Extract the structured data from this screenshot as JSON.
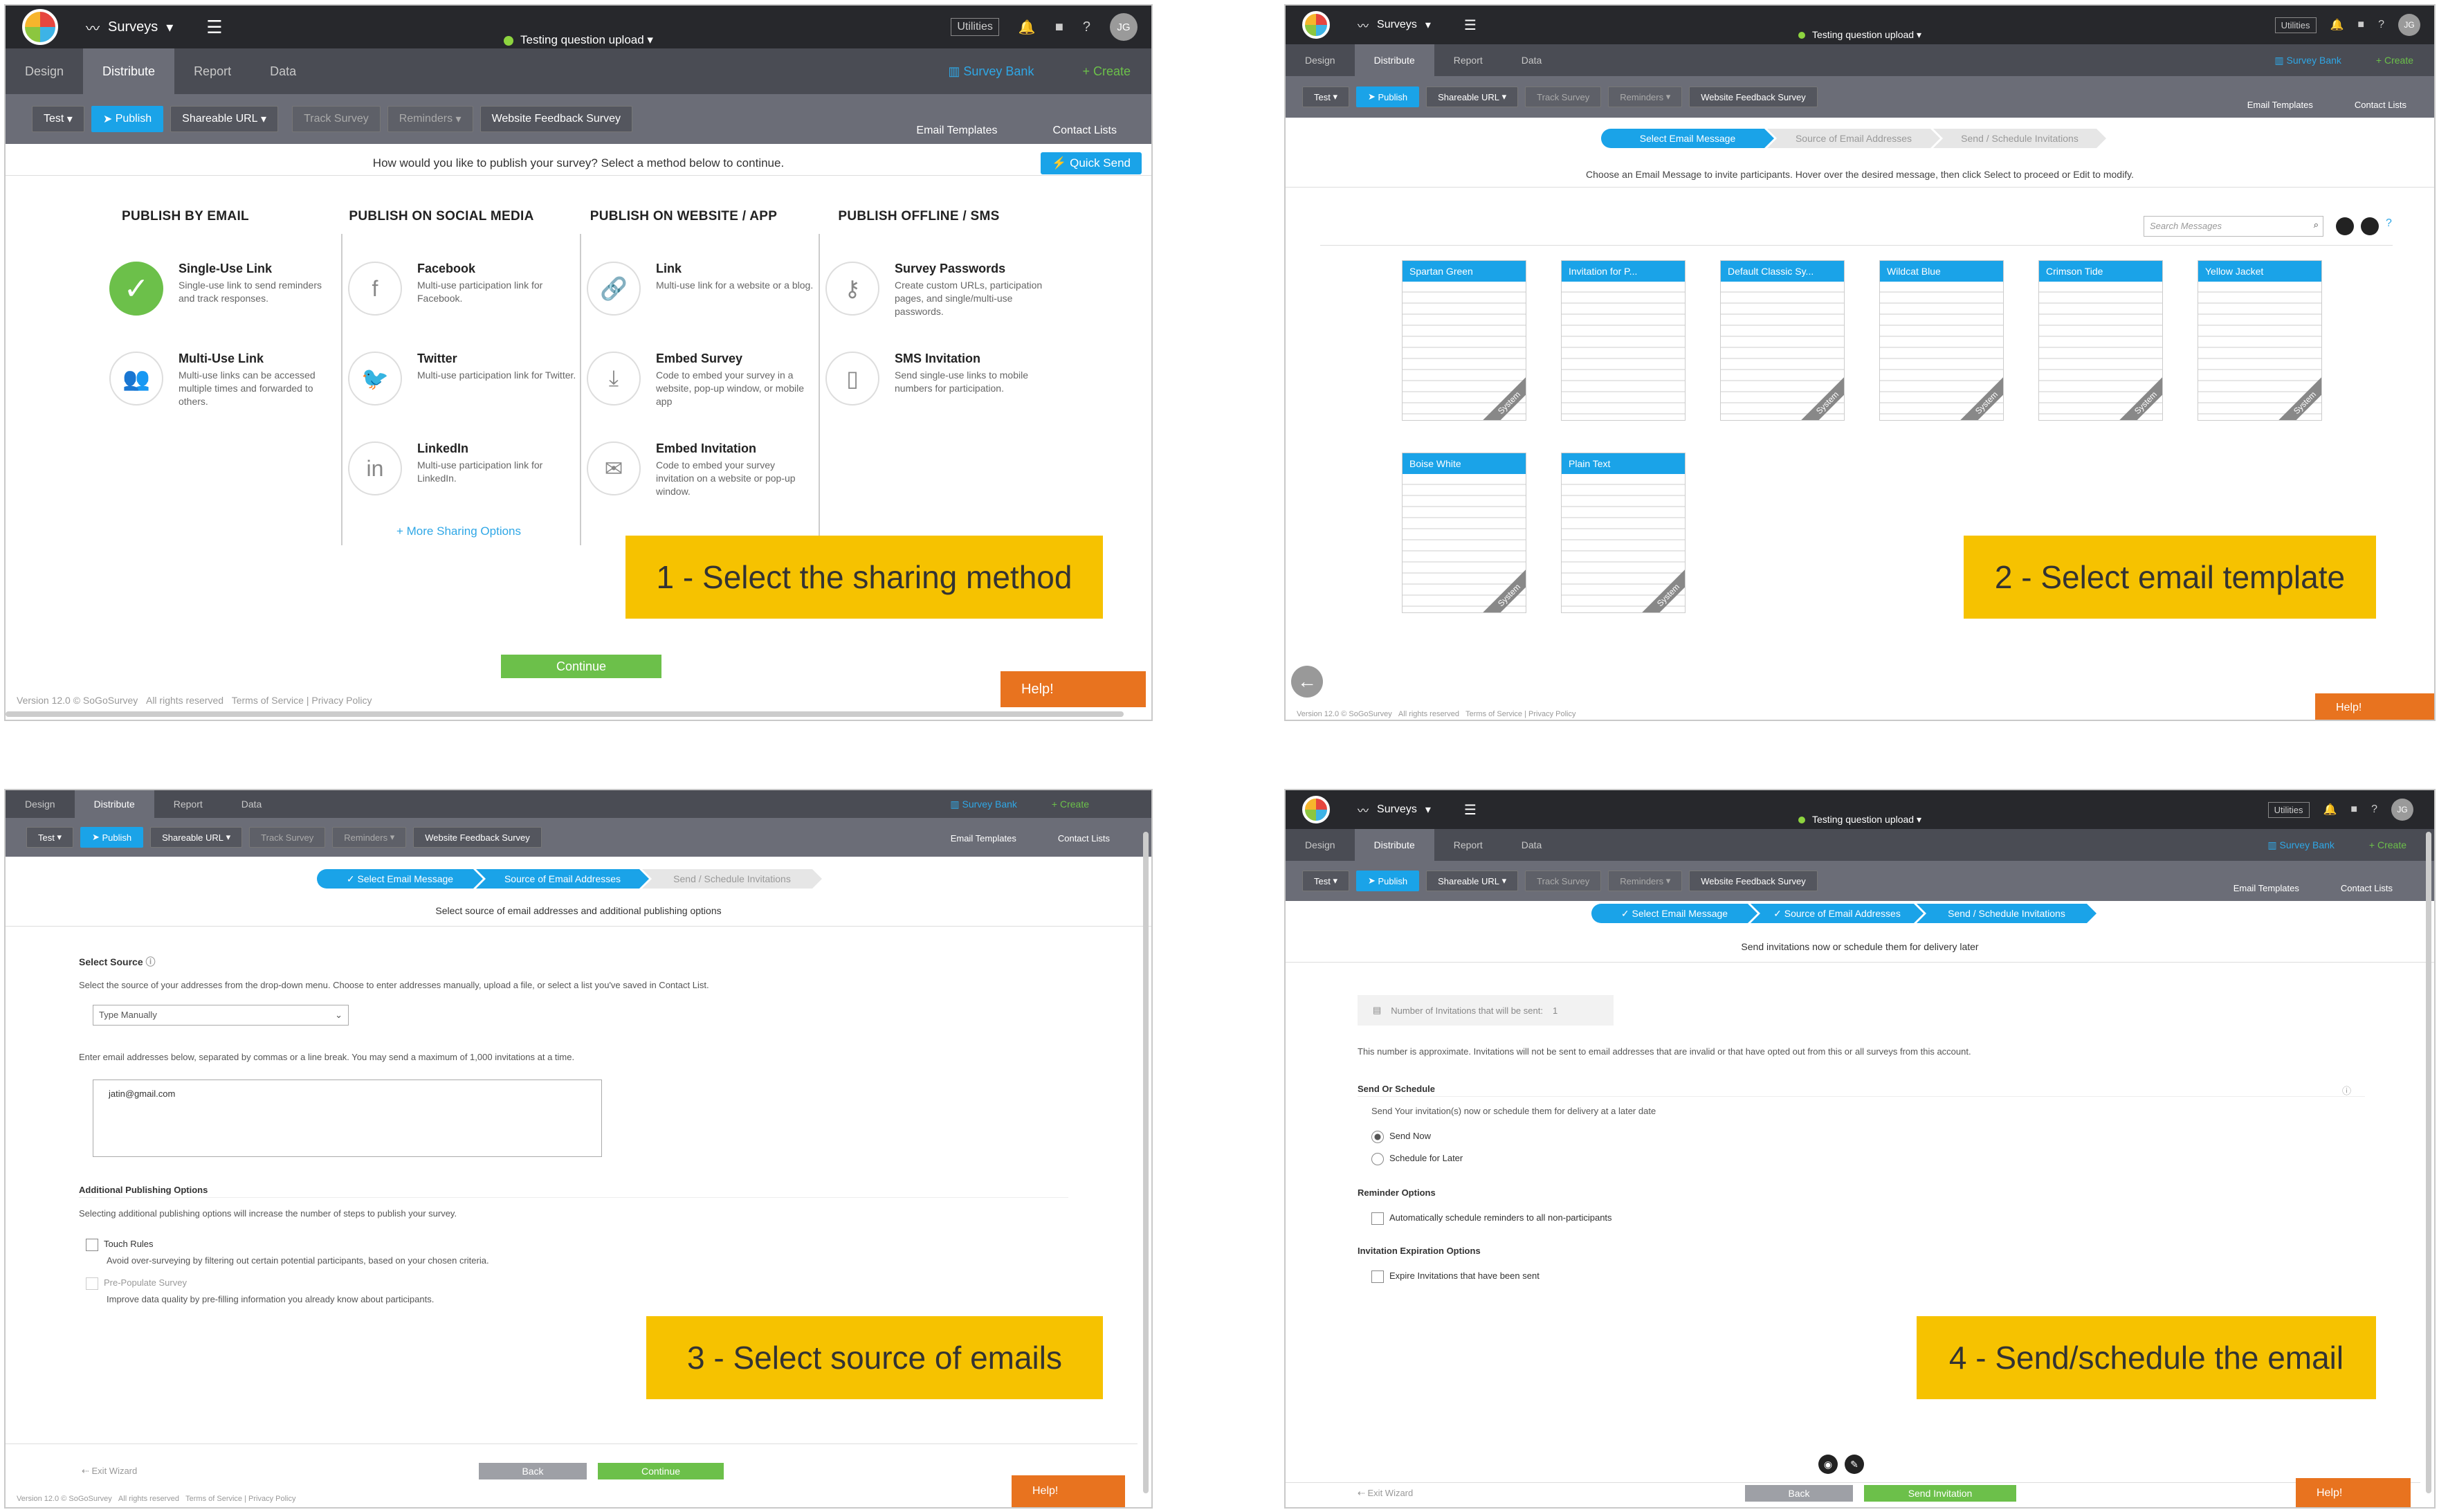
{
  "app": {
    "surveys_label": "Surveys",
    "survey_title": "Testing question upload",
    "utilities_label": "Utilities",
    "avatar_initials": "JG"
  },
  "tabs": [
    "Design",
    "Distribute",
    "Report",
    "Data"
  ],
  "tab_actions": {
    "survey_bank": "Survey Bank",
    "create": "Create"
  },
  "action_bar": {
    "test": "Test",
    "publish": "Publish",
    "shareable_url": "Shareable URL",
    "track_survey": "Track Survey",
    "reminders": "Reminders",
    "website_feedback": "Website Feedback Survey",
    "email_templates": "Email Templates",
    "contact_lists": "Contact Lists"
  },
  "panel1": {
    "question": "How would you like to publish your survey? Select a method below to continue.",
    "quick_send": "Quick Send",
    "columns": [
      {
        "header": "PUBLISH BY EMAIL",
        "items": [
          {
            "title": "Single-Use Link",
            "desc": "Single-use link to send reminders and track responses.",
            "icon": "check-icon"
          },
          {
            "title": "Multi-Use Link",
            "desc": "Multi-use links can be accessed multiple times and forwarded to others.",
            "icon": "people-icon"
          }
        ]
      },
      {
        "header": "PUBLISH ON SOCIAL MEDIA",
        "items": [
          {
            "title": "Facebook",
            "desc": "Multi-use participation link for Facebook.",
            "icon": "facebook-icon"
          },
          {
            "title": "Twitter",
            "desc": "Multi-use participation link for Twitter.",
            "icon": "twitter-icon"
          },
          {
            "title": "LinkedIn",
            "desc": "Multi-use participation link for LinkedIn.",
            "icon": "linkedin-icon"
          }
        ]
      },
      {
        "header": "PUBLISH ON WEBSITE / APP",
        "items": [
          {
            "title": "Link",
            "desc": "Multi-use link for a website or a blog.",
            "icon": "link-icon"
          },
          {
            "title": "Embed Survey",
            "desc": "Code to embed your survey in a website, pop-up window, or mobile app",
            "icon": "download-icon"
          },
          {
            "title": "Embed Invitation",
            "desc": "Code to embed your survey invitation on a website or pop-up window.",
            "icon": "mail-icon"
          }
        ]
      },
      {
        "header": "PUBLISH OFFLINE / SMS",
        "items": [
          {
            "title": "Survey Passwords",
            "desc": "Create custom URLs, participation pages, and single/multi-use passwords.",
            "icon": "key-icon"
          },
          {
            "title": "SMS Invitation",
            "desc": "Send single-use links to mobile numbers for participation.",
            "icon": "phone-icon"
          }
        ]
      }
    ],
    "more_sharing": "+ More Sharing Options",
    "continue": "Continue",
    "callout": "1 - Select the sharing method"
  },
  "panel2": {
    "steps": [
      "Select Email Message",
      "Source of Email Addresses",
      "Send / Schedule Invitations"
    ],
    "instruction": "Choose an Email Message to invite participants. Hover over the desired message, then click Select to proceed or Edit to modify.",
    "search_placeholder": "Search Messages",
    "templates": [
      {
        "name": "Spartan Green",
        "color": "#1aa3e8"
      },
      {
        "name": "Invitation for P...",
        "color": "#1aa3e8"
      },
      {
        "name": "Default Classic Sy...",
        "color": "#1aa3e8"
      },
      {
        "name": "Wildcat Blue",
        "color": "#1aa3e8"
      },
      {
        "name": "Crimson Tide",
        "color": "#1aa3e8"
      },
      {
        "name": "Yellow Jacket",
        "color": "#1aa3e8"
      },
      {
        "name": "Boise White",
        "color": "#1aa3e8"
      },
      {
        "name": "Plain Text",
        "color": "#1aa3e8"
      }
    ],
    "system_label": "System",
    "callout": "2 - Select email template"
  },
  "panel3": {
    "steps": [
      "Select Email Message",
      "Source of Email Addresses",
      "Send / Schedule Invitations"
    ],
    "subtitle": "Select source of email addresses and additional publishing options",
    "select_source": "Select Source",
    "source_desc": "Select the source of your addresses from the drop-down menu. Choose to enter addresses manually, upload a file, or select a list you've saved in Contact List.",
    "source_value": "Type Manually",
    "enter_desc": "Enter email addresses below, separated by commas or a line break. You may send a maximum of 1,000 invitations at a time.",
    "email_value": "jatin@gmail.com",
    "additional": "Additional Publishing Options",
    "additional_desc": "Selecting additional publishing options will increase the number of steps to publish your survey.",
    "touch_rules": "Touch Rules",
    "touch_desc": "Avoid over-surveying by filtering out certain potential participants, based on your chosen criteria.",
    "prepopulate": "Pre-Populate Survey",
    "prepop_desc": "Improve data quality by pre-filling information you already know about participants.",
    "exit": "Exit Wizard",
    "back": "Back",
    "continue": "Continue",
    "callout": "3 - Select source of emails"
  },
  "panel4": {
    "steps": [
      "Select Email Message",
      "Source of Email Addresses",
      "Send / Schedule Invitations"
    ],
    "subtitle": "Send invitations now or schedule them for delivery later",
    "num_label": "Number of Invitations that will be sent:",
    "num_value": "1",
    "approx": "This number is approximate. Invitations will not be sent to email addresses that are invalid or that have opted out from this or all surveys from this account.",
    "send_or_schedule": "Send Or Schedule",
    "send_desc": "Send Your invitation(s) now or schedule them for delivery at a later date",
    "send_now": "Send Now",
    "schedule_later": "Schedule for Later",
    "reminder_options": "Reminder Options",
    "reminder_auto": "Automatically schedule reminders to all non-participants",
    "expiration": "Invitation Expiration Options",
    "expire": "Expire Invitations that have been sent",
    "exit": "Exit Wizard",
    "back": "Back",
    "send_invitation": "Send Invitation",
    "callout": "4 - Send/schedule the email"
  },
  "footer": {
    "version": "Version 12.0 © SoGoSurvey",
    "rights": "All rights reserved",
    "terms": "Terms of Service | Privacy Policy"
  },
  "help": "Help!"
}
